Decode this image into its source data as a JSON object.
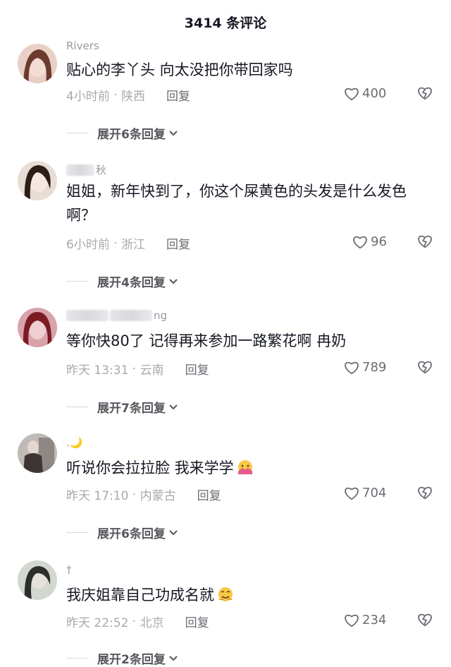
{
  "header": {
    "title": "3414 条评论"
  },
  "comments": [
    {
      "username": "Rivers",
      "text": "贴心的李丫头 向太没把你带回家吗",
      "time": "4小时前",
      "location": "陕西",
      "reply_label": "回复",
      "likes": "400",
      "expand": "展开6条回复",
      "avatar_colors": [
        "#f1d6cf",
        "#6b3b2e"
      ]
    },
    {
      "username": "秋",
      "text": "姐姐，新年快到了，你这个屎黄色的头发是什么发色啊？",
      "time": "6小时前",
      "location": "浙江",
      "reply_label": "回复",
      "likes": "96",
      "expand": "展开4条回复",
      "avatar_colors": [
        "#efe3da",
        "#2c1d17"
      ]
    },
    {
      "username": "ng",
      "text": "等你快80了 记得再来参加一路繁花啊 冉奶",
      "time": "昨天 13:31",
      "location": "云南",
      "reply_label": "回复",
      "likes": "789",
      "expand": "展开7条回复",
      "avatar_colors": [
        "#e7b8bf",
        "#7a1c24"
      ]
    },
    {
      "username": ".🌙",
      "text": "听说你会拉拉脸 我来学学",
      "time": "昨天 17:10",
      "location": "内蒙古",
      "reply_label": "回复",
      "likes": "704",
      "expand": "展开6条回复",
      "avatar_colors": [
        "#c4c0bd",
        "#3c3533"
      ]
    },
    {
      "username": "†",
      "text": "我庆姐靠自己功成名就",
      "time": "昨天 22:52",
      "location": "北京",
      "reply_label": "回复",
      "likes": "234",
      "expand": "展开2条回复",
      "avatar_colors": [
        "#d7ddd6",
        "#2d2f2c"
      ]
    }
  ]
}
